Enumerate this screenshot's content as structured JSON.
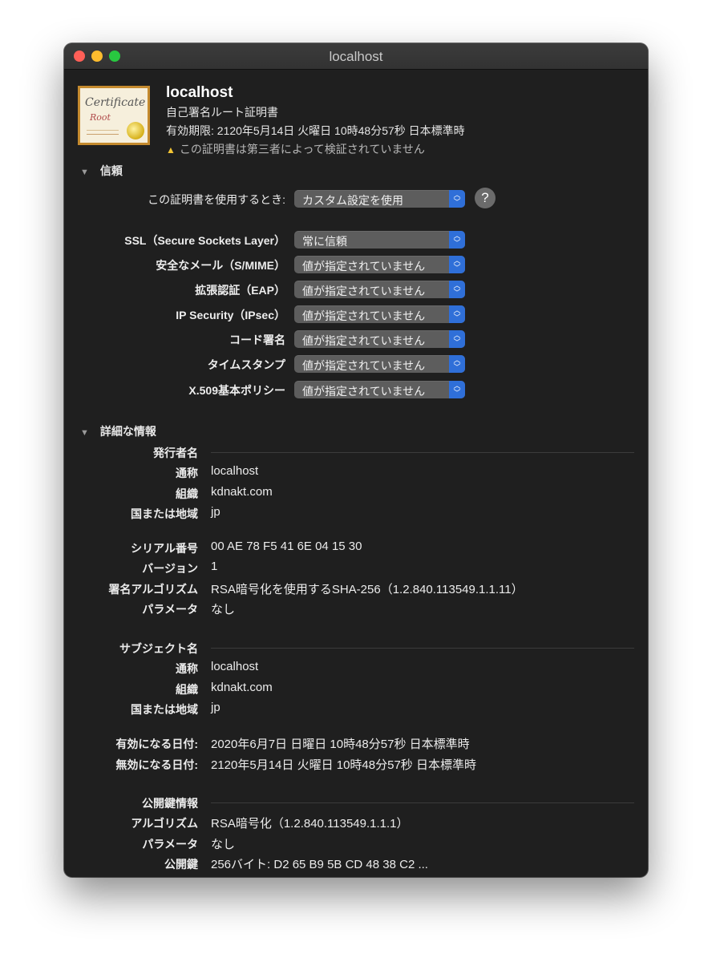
{
  "window": {
    "title": "localhost"
  },
  "header": {
    "icon_word": "Certificate",
    "icon_root": "Root",
    "name": "localhost",
    "type": "自己署名ルート証明書",
    "expiry": "有効期限: 2120年5月14日 火曜日 10時48分57秒 日本標準時",
    "warning": "この証明書は第三者によって検証されていません"
  },
  "trust": {
    "heading": "信頼",
    "use_label": "この証明書を使用するとき:",
    "use_value": "カスタム設定を使用",
    "help": "?",
    "rows": [
      {
        "label": "SSL（Secure Sockets Layer）",
        "value": "常に信頼"
      },
      {
        "label": "安全なメール（S/MIME）",
        "value": "値が指定されていません"
      },
      {
        "label": "拡張認証（EAP）",
        "value": "値が指定されていません"
      },
      {
        "label": "IP Security（IPsec）",
        "value": "値が指定されていません"
      },
      {
        "label": "コード署名",
        "value": "値が指定されていません"
      },
      {
        "label": "タイムスタンプ",
        "value": "値が指定されていません"
      },
      {
        "label": "X.509基本ポリシー",
        "value": "値が指定されていません"
      }
    ]
  },
  "details": {
    "heading": "詳細な情報",
    "issuer_heading": "発行者名",
    "issuer": [
      {
        "label": "通称",
        "value": "localhost"
      },
      {
        "label": "組織",
        "value": "kdnakt.com"
      },
      {
        "label": "国または地域",
        "value": "jp"
      }
    ],
    "info": [
      {
        "label": "シリアル番号",
        "value": "00 AE 78 F5 41 6E 04 15 30"
      },
      {
        "label": "バージョン",
        "value": "1"
      },
      {
        "label": "署名アルゴリズム",
        "value": "RSA暗号化を使用するSHA-256（1.2.840.113549.1.1.11）"
      },
      {
        "label": "パラメータ",
        "value": "なし"
      }
    ],
    "subject_heading": "サブジェクト名",
    "subject": [
      {
        "label": "通称",
        "value": "localhost"
      },
      {
        "label": "組織",
        "value": "kdnakt.com"
      },
      {
        "label": "国または地域",
        "value": "jp"
      }
    ],
    "validity": [
      {
        "label": "有効になる日付:",
        "value": "2020年6月7日 日曜日 10時48分57秒 日本標準時"
      },
      {
        "label": "無効になる日付:",
        "value": "2120年5月14日 火曜日 10時48分57秒 日本標準時"
      }
    ],
    "pubkey_heading": "公開鍵情報",
    "pubkey": [
      {
        "label": "アルゴリズム",
        "value": "RSA暗号化（1.2.840.113549.1.1.1）"
      },
      {
        "label": "パラメータ",
        "value": "なし"
      },
      {
        "label": "公開鍵",
        "value": "256バイト: D2 65 B9 5B CD 48 38 C2 ..."
      }
    ]
  }
}
